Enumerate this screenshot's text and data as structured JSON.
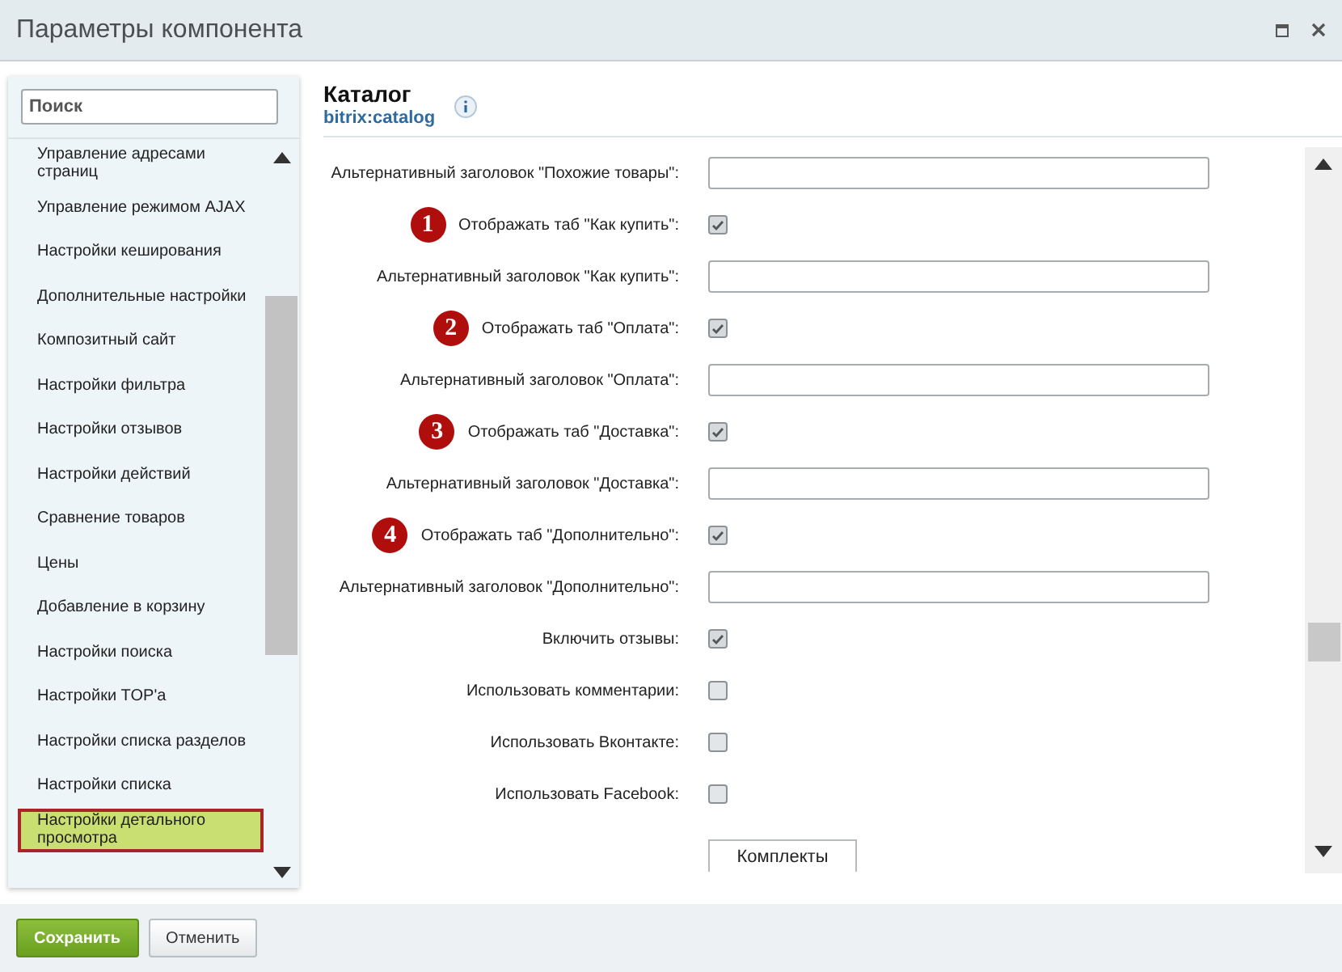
{
  "window": {
    "title": "Параметры компонента"
  },
  "sidebar": {
    "search": {
      "placeholder": "Поиск"
    },
    "items": [
      {
        "label": "Управление адресами страниц",
        "selected": false
      },
      {
        "label": "Управление режимом AJAX",
        "selected": false
      },
      {
        "label": "Настройки кеширования",
        "selected": false
      },
      {
        "label": "Дополнительные настройки",
        "selected": false
      },
      {
        "label": "Композитный сайт",
        "selected": false
      },
      {
        "label": "Настройки фильтра",
        "selected": false
      },
      {
        "label": "Настройки отзывов",
        "selected": false
      },
      {
        "label": "Настройки действий",
        "selected": false
      },
      {
        "label": "Сравнение товаров",
        "selected": false
      },
      {
        "label": "Цены",
        "selected": false
      },
      {
        "label": "Добавление в корзину",
        "selected": false
      },
      {
        "label": "Настройки поиска",
        "selected": false
      },
      {
        "label": "Настройки TOP'a",
        "selected": false
      },
      {
        "label": "Настройки списка разделов",
        "selected": false
      },
      {
        "label": "Настройки списка",
        "selected": false
      },
      {
        "label": "Настройки детального просмотра",
        "selected": true
      }
    ]
  },
  "component": {
    "title": "Каталог",
    "code": "bitrix:catalog"
  },
  "form": {
    "rows": [
      {
        "kind": "text",
        "label": "Альтернативный заголовок \"Похожие товары\":"
      },
      {
        "kind": "checkbox",
        "label": "Отображать таб \"Как купить\":",
        "checked": true,
        "badge": "1"
      },
      {
        "kind": "text",
        "label": "Альтернативный заголовок \"Как купить\":"
      },
      {
        "kind": "checkbox",
        "label": "Отображать таб \"Оплата\":",
        "checked": true,
        "badge": "2"
      },
      {
        "kind": "text",
        "label": "Альтернативный заголовок \"Оплата\":"
      },
      {
        "kind": "checkbox",
        "label": "Отображать таб \"Доставка\":",
        "checked": true,
        "badge": "3"
      },
      {
        "kind": "text",
        "label": "Альтернативный заголовок \"Доставка\":"
      },
      {
        "kind": "checkbox",
        "label": "Отображать таб \"Дополнительно\":",
        "checked": true,
        "badge": "4"
      },
      {
        "kind": "text",
        "label": "Альтернативный заголовок \"Дополнительно\":"
      },
      {
        "kind": "checkbox",
        "label": "Включить отзывы:",
        "checked": true
      },
      {
        "kind": "checkbox",
        "label": "Использовать комментарии:",
        "checked": false
      },
      {
        "kind": "checkbox",
        "label": "Использовать Вконтакте:",
        "checked": false
      },
      {
        "kind": "checkbox",
        "label": "Использовать Facebook:",
        "checked": false
      },
      {
        "kind": "button",
        "label": "Комплекты"
      }
    ]
  },
  "footer": {
    "buttons": [
      {
        "label": "Сохранить",
        "kind": "primary"
      },
      {
        "label": "Отменить",
        "kind": "secondary"
      }
    ]
  }
}
